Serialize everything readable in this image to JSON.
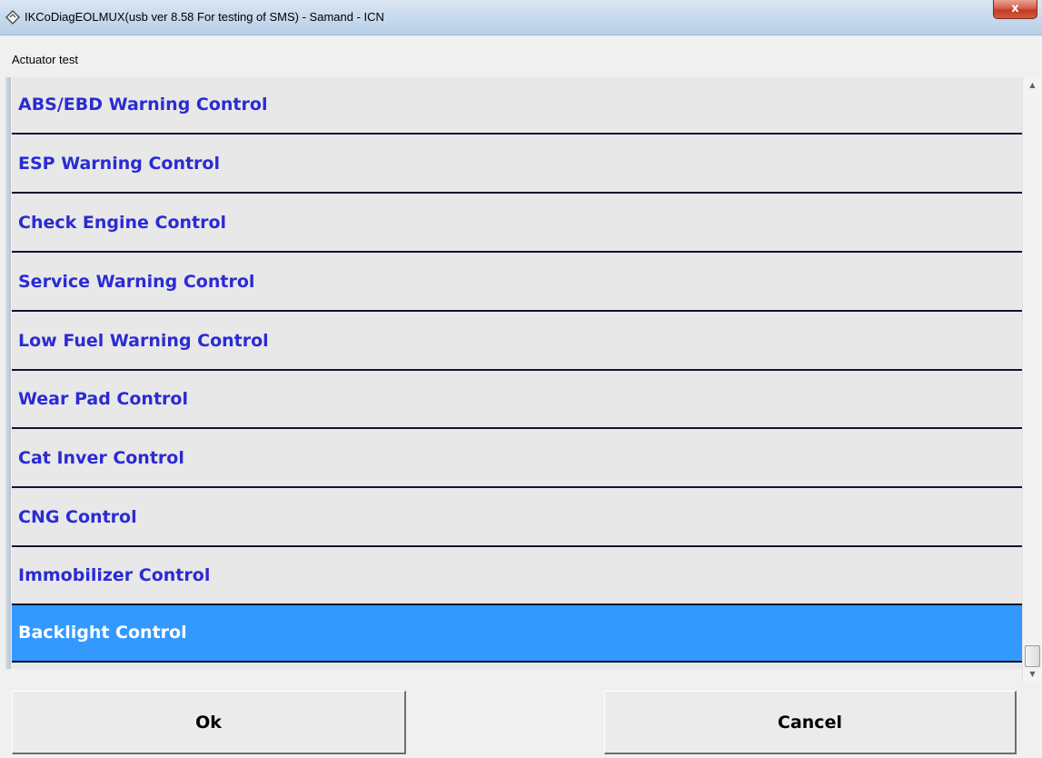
{
  "window": {
    "title": "IKCoDiagEOLMUX(usb ver 8.58 For testing of SMS)  - Samand - ICN",
    "close_glyph": "x"
  },
  "panel": {
    "label": "Actuator test"
  },
  "list": {
    "items": [
      {
        "label": "ABS/EBD Warning Control"
      },
      {
        "label": "ESP Warning Control"
      },
      {
        "label": "Check Engine Control"
      },
      {
        "label": "Service Warning Control"
      },
      {
        "label": "Low Fuel Warning Control"
      },
      {
        "label": "Wear Pad Control"
      },
      {
        "label": "Cat Inver Control"
      },
      {
        "label": "CNG Control"
      },
      {
        "label": "Immobilizer Control"
      },
      {
        "label": "Backlight Control"
      }
    ],
    "selected_index": 9
  },
  "scrollbar": {
    "up_glyph": "▲",
    "down_glyph": "▼"
  },
  "buttons": {
    "ok_label": "Ok",
    "cancel_label": "Cancel"
  },
  "colors": {
    "item_text": "#2b2bd4",
    "selected_bg": "#3399ff",
    "selected_text": "#ffffff",
    "separator": "#0f1430"
  },
  "icons": {
    "app": "app-icon",
    "close": "close-icon"
  }
}
